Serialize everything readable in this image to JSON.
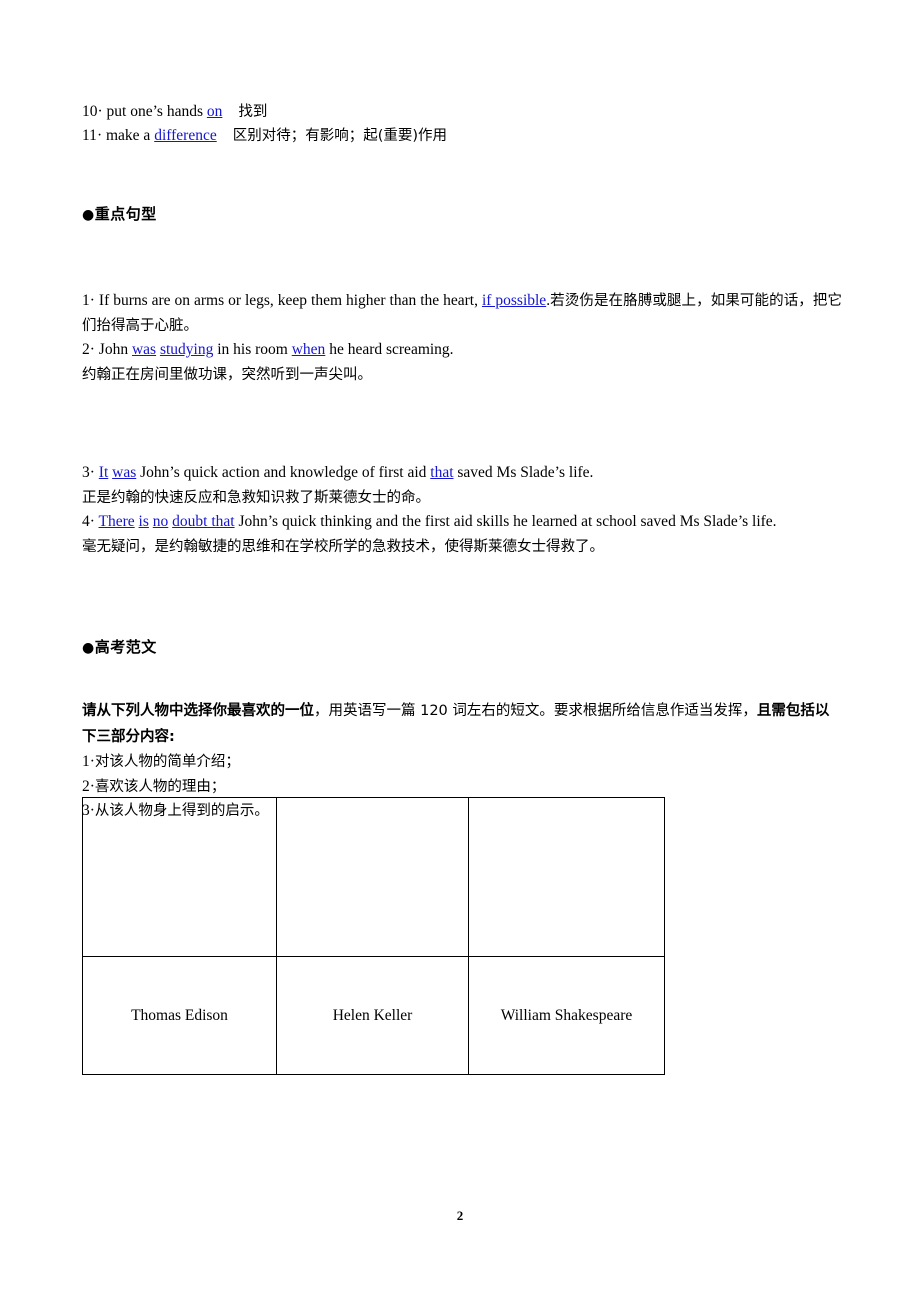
{
  "document": {
    "page_number": "2",
    "link_color": "#1414d2"
  },
  "vocab": {
    "items": [
      {
        "number": "10",
        "sep": "·",
        "pre": "put one’s hands ",
        "link": "on",
        "post": "",
        "gloss": "找到"
      },
      {
        "number": "11",
        "sep": "·",
        "pre": "make a ",
        "link": "difference",
        "post": "",
        "gloss": "区别对待；有影响；起(重要)作用"
      }
    ]
  },
  "sections": [
    {
      "bullet": "●",
      "title": "重点句型"
    },
    {
      "bullet": "●",
      "title": "高考范文"
    }
  ],
  "sentence_patterns": [
    {
      "number": "1",
      "sep": "·",
      "english_parts": [
        {
          "text": "If burns are on arms or legs, keep them higher than the heart, ",
          "link": false
        },
        {
          "text": "if possible",
          "link": true
        },
        {
          "text": ".",
          "link": false
        }
      ],
      "chinese": "若烫伤是在胳膊或腿上，如果可能的话，把它们抬得高于心脏。",
      "inline_chinese": true
    },
    {
      "number": "2",
      "sep": "·",
      "english_parts": [
        {
          "text": "John ",
          "link": false
        },
        {
          "text": "was",
          "link": true
        },
        {
          "text": " ",
          "link": false
        },
        {
          "text": "studying",
          "link": true
        },
        {
          "text": " in his room ",
          "link": false
        },
        {
          "text": "when",
          "link": true
        },
        {
          "text": " he heard screaming.",
          "link": false
        }
      ],
      "chinese": "约翰正在房间里做功课，突然听到一声尖叫。",
      "inline_chinese": false
    },
    {
      "number": "3",
      "sep": "·",
      "english_parts": [
        {
          "text": "It",
          "link": true
        },
        {
          "text": " ",
          "link": false
        },
        {
          "text": "was",
          "link": true
        },
        {
          "text": " John’s quick action and knowledge of first aid ",
          "link": false
        },
        {
          "text": "that",
          "link": true
        },
        {
          "text": " saved Ms Slade’s life.",
          "link": false
        }
      ],
      "chinese": "正是约翰的快速反应和急救知识救了斯莱德女士的命。",
      "inline_chinese": false
    },
    {
      "number": "4",
      "sep": "·",
      "english_parts": [
        {
          "text": "There",
          "link": true
        },
        {
          "text": " ",
          "link": false
        },
        {
          "text": "is",
          "link": true
        },
        {
          "text": " ",
          "link": false
        },
        {
          "text": "no",
          "link": true
        },
        {
          "text": " ",
          "link": false
        },
        {
          "text": "doubt that",
          "link": true
        },
        {
          "text": " John’s quick thinking and the first aid skills he learned at school saved Ms Slade’s life.",
          "link": false
        }
      ],
      "chinese": "毫无疑问，是约翰敏捷的思维和在学校所学的急救技术，使得斯莱德女士得救了。",
      "inline_chinese": false
    }
  ],
  "writing_prompt": {
    "bold_lead": "请从下列人物中选择你最喜欢的一位",
    "normal_mid": "，用英语写一篇 120 词左右的短文。要求根据所给信息作适当发挥，",
    "bold_tail": "且需包括以下三部分内容:",
    "requirements": [
      {
        "number": "1",
        "sep": "·",
        "text": "对该人物的简单介绍；"
      },
      {
        "number": "2",
        "sep": "·",
        "text": "喜欢该人物的理由；"
      },
      {
        "number": "3",
        "sep": "·",
        "text": "从该人物身上得到的启示。"
      }
    ]
  },
  "figure_table": {
    "image_row": [
      "",
      "",
      ""
    ],
    "names": [
      "Thomas Edison",
      "Helen Keller",
      "William Shakespeare"
    ]
  }
}
